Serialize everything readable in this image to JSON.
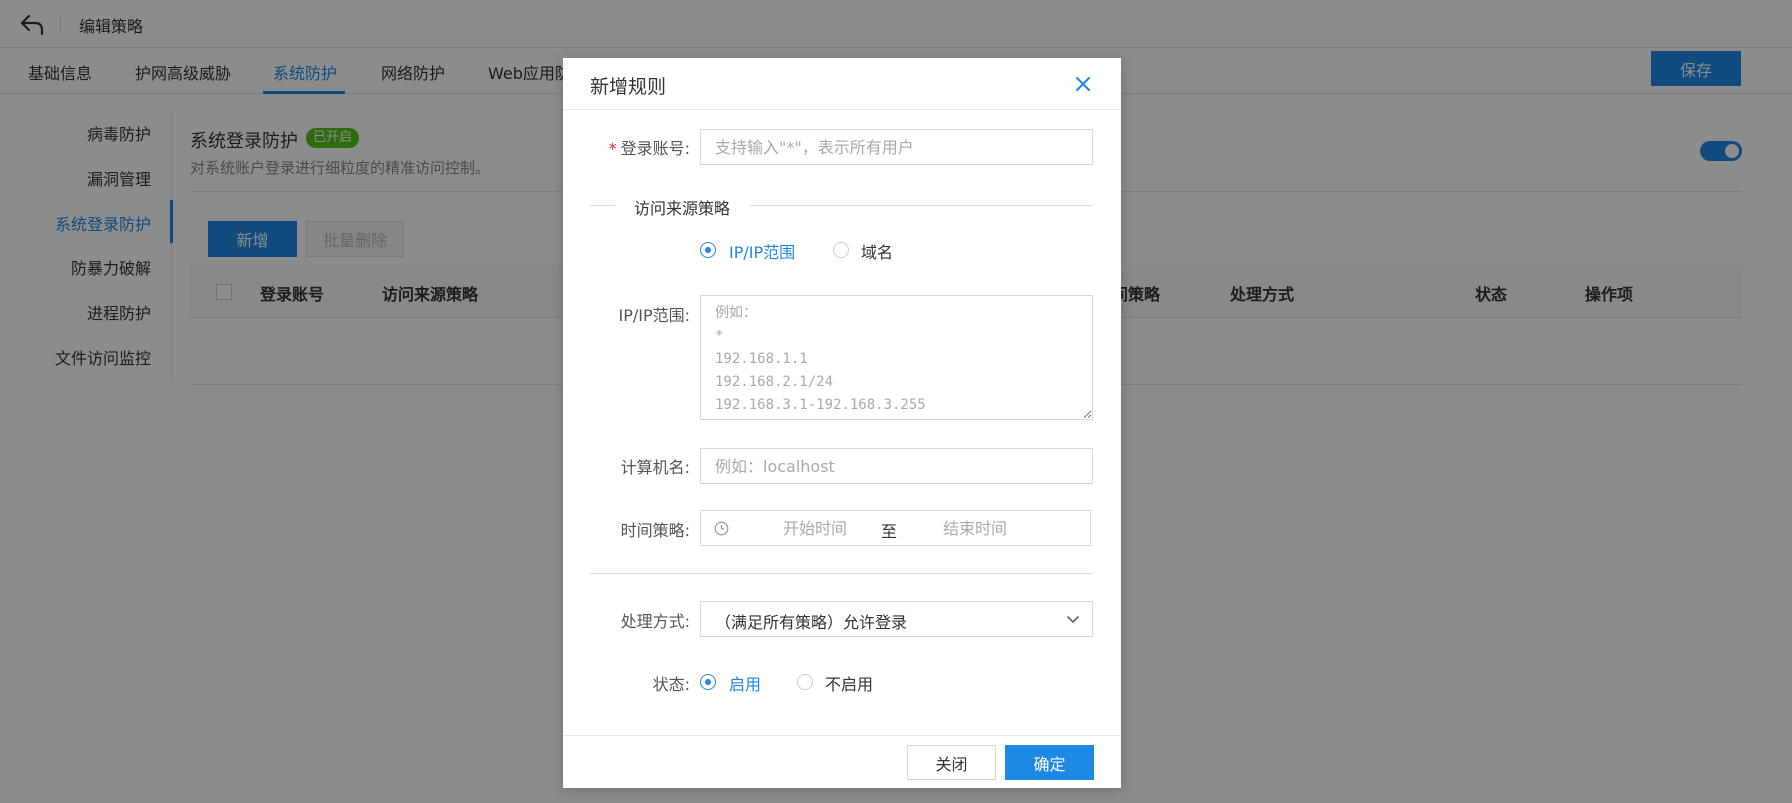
{
  "header": {
    "title": "编辑策略"
  },
  "tabs": [
    {
      "label": "基础信息"
    },
    {
      "label": "护网高级威胁"
    },
    {
      "label": "系统防护"
    },
    {
      "label": "网络防护"
    },
    {
      "label": "Web应用防"
    }
  ],
  "toolbar": {
    "save_label": "保存"
  },
  "sidebar": {
    "items": [
      {
        "label": "病毒防护"
      },
      {
        "label": "漏洞管理"
      },
      {
        "label": "系统登录防护"
      },
      {
        "label": "防暴力破解"
      },
      {
        "label": "进程防护"
      },
      {
        "label": "文件访问监控"
      }
    ]
  },
  "section": {
    "title": "系统登录防护",
    "badge": "已开启",
    "description": "对系统账户登录进行细粒度的精准访问控制。"
  },
  "actions": {
    "add_label": "新增",
    "batch_delete_label": "批量删除"
  },
  "table": {
    "columns": [
      {
        "label": "登录账号"
      },
      {
        "label": "访问来源策略"
      },
      {
        "label": "间策略"
      },
      {
        "label": "处理方式"
      },
      {
        "label": "状态"
      },
      {
        "label": "操作项"
      }
    ]
  },
  "modal": {
    "title": "新增规则",
    "account": {
      "label": "登录账号:",
      "required_mark": "*",
      "placeholder": "支持输入\"*\"，表示所有用户",
      "value": ""
    },
    "source_section": "访问来源策略",
    "source_options": [
      {
        "label": "IP/IP范围",
        "checked": true
      },
      {
        "label": "域名",
        "checked": false
      }
    ],
    "ip_range": {
      "label": "IP/IP范围:",
      "placeholder": "例如：\n*\n192.168.1.1\n192.168.2.1/24\n192.168.3.1-192.168.3.255"
    },
    "hostname": {
      "label": "计算机名:",
      "placeholder": "例如：localhost"
    },
    "time_policy": {
      "label": "时间策略:",
      "start_placeholder": "开始时间",
      "separator": "至",
      "end_placeholder": "结束时间"
    },
    "action": {
      "label": "处理方式:",
      "value": "（满足所有策略）允许登录"
    },
    "status": {
      "label": "状态:",
      "options": [
        {
          "label": "启用",
          "checked": true
        },
        {
          "label": "不启用",
          "checked": false
        }
      ]
    },
    "footer": {
      "cancel_label": "关闭",
      "ok_label": "确定"
    }
  },
  "colors": {
    "accent": "#1e88e5",
    "success": "#52c41a",
    "required": "#f5222d",
    "overlay": "rgba(0,0,0,0.45)"
  },
  "icons": {
    "back": "back-arrow-icon",
    "close": "close-icon",
    "clock": "clock-icon",
    "select": "chevron-down-icon"
  }
}
